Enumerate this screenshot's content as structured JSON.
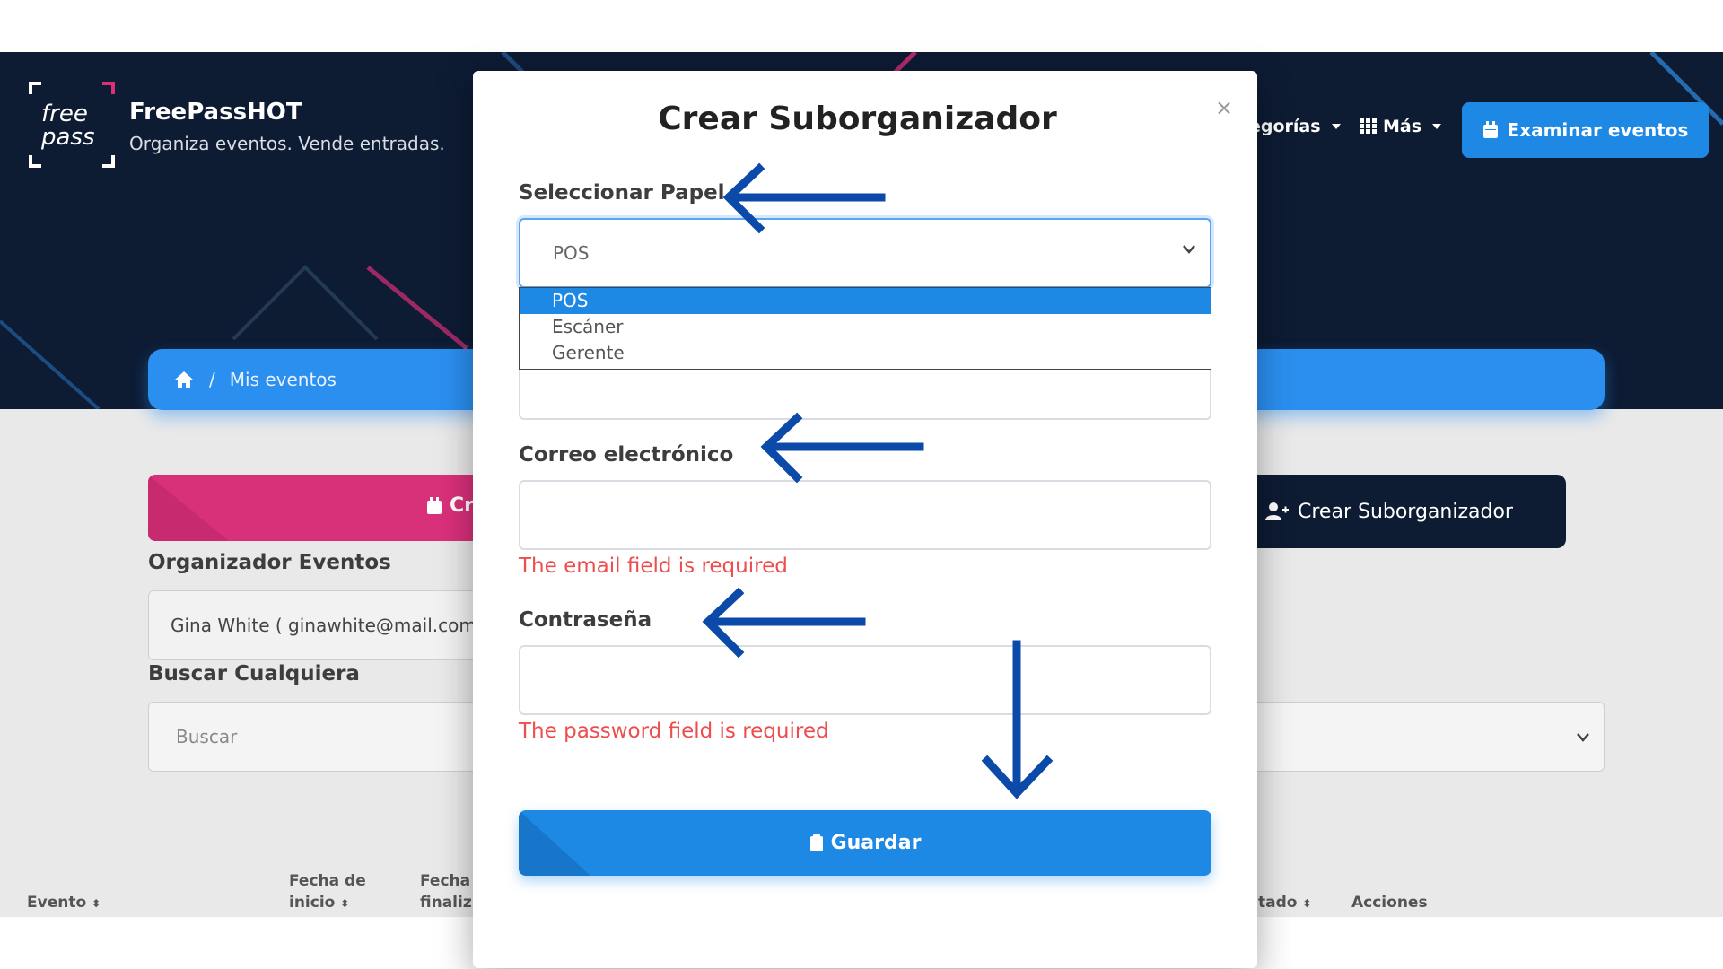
{
  "header": {
    "brand_title": "FreePassHOT",
    "brand_subtitle": "Organiza eventos. Vende entradas.",
    "logo_text_1": "free",
    "logo_text_2": "pass",
    "nav_categories": "egorías",
    "nav_more": "Más",
    "explore_button": "Examinar eventos"
  },
  "breadcrumb": {
    "separator": "/",
    "current": "Mis eventos"
  },
  "page": {
    "create_event_button": "Cr",
    "create_suborganizer_button": "Crear Suborganizador",
    "organizer_label": "Organizador Eventos",
    "organizer_value": "Gina White ( ginawhite@mail.com )",
    "search_label": "Buscar Cualquiera",
    "search_placeholder": "Buscar",
    "table_headers": {
      "event": "Evento",
      "start_date_1": "Fecha de",
      "start_date_2": "inicio",
      "end_date_1": "Fecha",
      "end_date_2": "finaliz",
      "status": "tado",
      "actions": "Acciones"
    }
  },
  "modal": {
    "title": "Crear Suborganizador",
    "close": "×",
    "role_label": "Seleccionar Papel",
    "role_selected": "POS",
    "role_options": [
      "POS",
      "Escáner",
      "Gerente"
    ],
    "email_label": "Correo electrónico",
    "email_error": "The email field is required",
    "password_label": "Contraseña",
    "password_error": "The password field is required",
    "save_button": "Guardar"
  },
  "colors": {
    "primary": "#1e88e5",
    "hero_bg": "#0d1b33",
    "pink": "#d9307a",
    "error": "#ee4d4d",
    "annotation_arrow": "#0b4aa8"
  }
}
